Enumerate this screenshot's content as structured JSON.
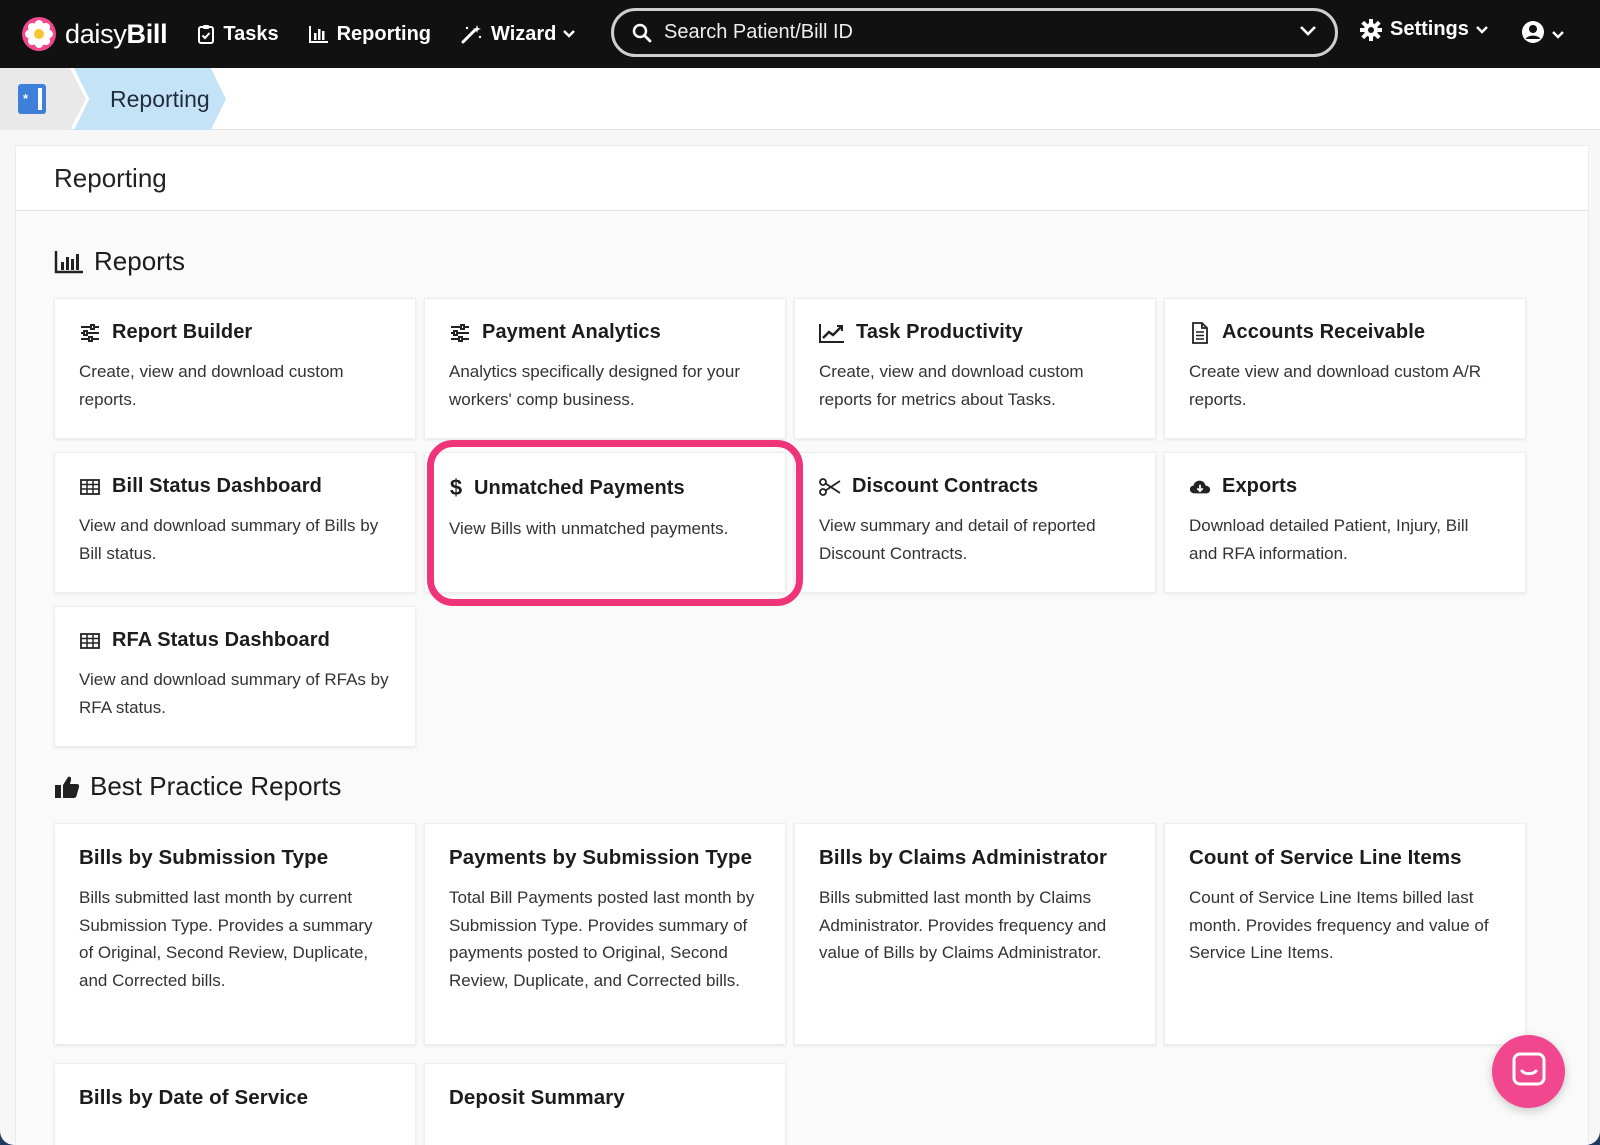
{
  "brand": {
    "name_light": "daisy",
    "name_bold": "Bill",
    "accent": "#f0478f"
  },
  "nav": {
    "tasks": "Tasks",
    "reporting": "Reporting",
    "wizard": "Wizard",
    "settings": "Settings"
  },
  "search": {
    "placeholder": "Search Patient/Bill ID"
  },
  "breadcrumb": {
    "current": "Reporting"
  },
  "page": {
    "title": "Reporting"
  },
  "reports": {
    "heading": "Reports",
    "cards": [
      {
        "icon": "sliders-icon",
        "title": "Report Builder",
        "desc": "Create, view and download custom reports."
      },
      {
        "icon": "sliders-icon",
        "title": "Payment Analytics",
        "desc": "Analytics specifically designed for your workers' comp business."
      },
      {
        "icon": "line-chart-icon",
        "title": "Task Productivity",
        "desc": "Create, view and download custom reports for metrics about Tasks."
      },
      {
        "icon": "document-icon",
        "title": "Accounts Receivable",
        "desc": "Create view and download custom A/R reports."
      },
      {
        "icon": "table-icon",
        "title": "Bill Status Dashboard",
        "desc": "View and download summary of Bills by Bill status."
      },
      {
        "icon": "dollar-icon",
        "title": "Unmatched Payments",
        "desc": "View Bills with unmatched payments."
      },
      {
        "icon": "scissors-icon",
        "title": "Discount Contracts",
        "desc": "View summary and detail of reported Discount Contracts."
      },
      {
        "icon": "cloud-download-icon",
        "title": "Exports",
        "desc": "Download detailed Patient, Injury, Bill and RFA information."
      },
      {
        "icon": "table-icon",
        "title": "RFA Status Dashboard",
        "desc": "View and download summary of RFAs by RFA status."
      }
    ]
  },
  "best_practice": {
    "heading": "Best Practice Reports",
    "cards": [
      {
        "title": "Bills by Submission Type",
        "desc": "Bills submitted last month by current Submission Type. Provides a summary of Original, Second Review, Duplicate, and Corrected bills."
      },
      {
        "title": "Payments by Submission Type",
        "desc": "Total Bill Payments posted last month by Submission Type. Provides summary of payments posted to Original, Second Review, Duplicate, and Corrected bills."
      },
      {
        "title": "Bills by Claims Administrator",
        "desc": "Bills submitted last month by Claims Administrator. Provides frequency and value of Bills by Claims Administrator."
      },
      {
        "title": "Count of Service Line Items",
        "desc": "Count of Service Line Items billed last month. Provides frequency and value of Service Line Items."
      },
      {
        "title": "Bills by Date of Service",
        "desc": ""
      },
      {
        "title": "Deposit Summary",
        "desc": ""
      }
    ]
  },
  "highlight_color": "#f0347a"
}
